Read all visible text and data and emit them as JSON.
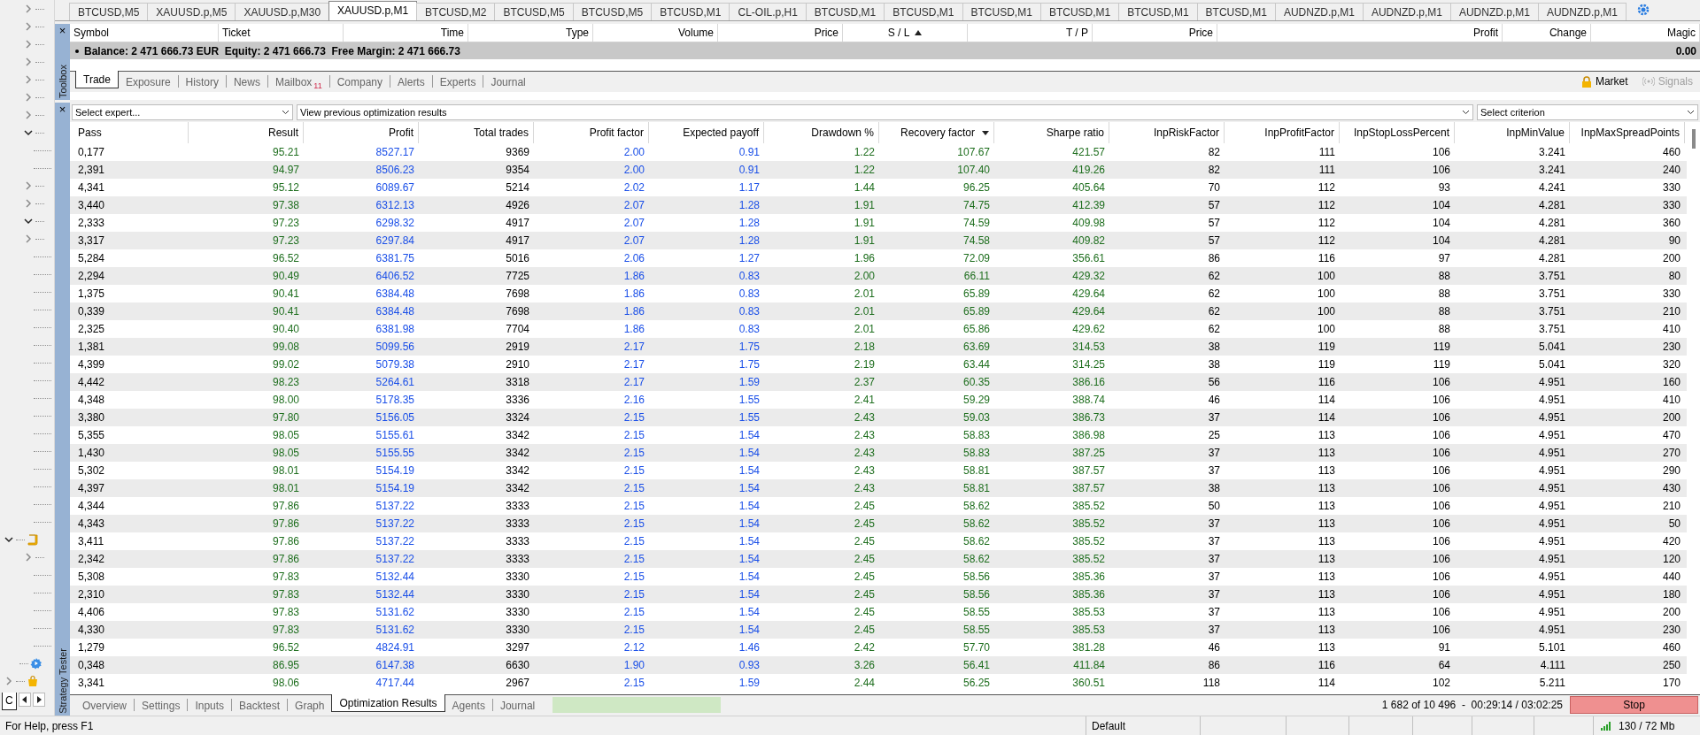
{
  "chart_tabs": [
    {
      "label": "BTCUSD,M5",
      "selected": false
    },
    {
      "label": "XAUUSD.p,M5",
      "selected": false
    },
    {
      "label": "XAUUSD.p,M30",
      "selected": false
    },
    {
      "label": "XAUUSD.p,M1",
      "selected": true
    },
    {
      "label": "BTCUSD,M2",
      "selected": false
    },
    {
      "label": "BTCUSD,M5",
      "selected": false
    },
    {
      "label": "BTCUSD,M5",
      "selected": false
    },
    {
      "label": "BTCUSD,M1",
      "selected": false
    },
    {
      "label": "CL-OIL.p,H1",
      "selected": false
    },
    {
      "label": "BTCUSD,M1",
      "selected": false
    },
    {
      "label": "BTCUSD,M1",
      "selected": false
    },
    {
      "label": "BTCUSD,M1",
      "selected": false
    },
    {
      "label": "BTCUSD,M1",
      "selected": false
    },
    {
      "label": "BTCUSD,M1",
      "selected": false
    },
    {
      "label": "BTCUSD,M1",
      "selected": false
    },
    {
      "label": "AUDNZD.p,M1",
      "selected": false
    },
    {
      "label": "AUDNZD.p,M1",
      "selected": false
    },
    {
      "label": "AUDNZD.p,M1",
      "selected": false
    },
    {
      "label": "AUDNZD.p,M1",
      "selected": false
    }
  ],
  "navigator": {
    "items": [
      {
        "kind": "group",
        "expanded": false
      },
      {
        "kind": "group",
        "expanded": false
      },
      {
        "kind": "group",
        "expanded": false
      },
      {
        "kind": "group",
        "expanded": false
      },
      {
        "kind": "group",
        "expanded": false
      },
      {
        "kind": "group",
        "expanded": false
      },
      {
        "kind": "group",
        "expanded": false
      },
      {
        "kind": "group",
        "expanded": true,
        "children": [
          {
            "kind": "leaf"
          },
          {
            "kind": "leaf"
          },
          {
            "kind": "group",
            "expanded": false
          },
          {
            "kind": "group",
            "expanded": false
          },
          {
            "kind": "group",
            "expanded": true,
            "children": [
              {
                "kind": "group",
                "expanded": false
              },
              {
                "kind": "leaf"
              },
              {
                "kind": "leaf"
              },
              {
                "kind": "leaf"
              },
              {
                "kind": "leaf"
              },
              {
                "kind": "leaf"
              },
              {
                "kind": "leaf"
              },
              {
                "kind": "leaf"
              },
              {
                "kind": "leaf"
              },
              {
                "kind": "leaf"
              },
              {
                "kind": "leaf"
              },
              {
                "kind": "leaf"
              },
              {
                "kind": "leaf"
              },
              {
                "kind": "leaf"
              },
              {
                "kind": "leaf"
              },
              {
                "kind": "leaf"
              },
              {
                "kind": "leaf"
              }
            ]
          }
        ]
      },
      {
        "kind": "scripts",
        "expanded": true,
        "children": [
          {
            "kind": "group",
            "expanded": false
          },
          {
            "kind": "leaf"
          },
          {
            "kind": "leaf"
          },
          {
            "kind": "leaf"
          },
          {
            "kind": "leaf"
          },
          {
            "kind": "leaf"
          }
        ]
      },
      {
        "kind": "services"
      },
      {
        "kind": "market",
        "expanded": false
      }
    ],
    "tab": "C"
  },
  "toolbox": {
    "title": "Toolbox",
    "close": "×",
    "columns": [
      {
        "label": "Symbol"
      },
      {
        "label": "Ticket"
      },
      {
        "label": "Time"
      },
      {
        "label": "Type"
      },
      {
        "label": "Volume"
      },
      {
        "label": "Price"
      },
      {
        "label": "S / L",
        "sorted": true,
        "ascending": true
      },
      {
        "label": "T / P"
      },
      {
        "label": "Price"
      },
      {
        "label": "Profit"
      },
      {
        "label": "Change"
      },
      {
        "label": "Magic"
      }
    ],
    "balance": {
      "text": "Balance: 2 471 666.73 EUR  Equity: 2 471 666.73  Free Margin: 2 471 666.73",
      "profit": "0.00"
    },
    "tabs": [
      {
        "label": "Trade",
        "selected": true
      },
      {
        "label": "Exposure",
        "selected": false
      },
      {
        "label": "History",
        "selected": false
      },
      {
        "label": "News",
        "selected": false
      },
      {
        "label": "Mailbox",
        "selected": false,
        "badge": "11"
      },
      {
        "label": "Company",
        "selected": false
      },
      {
        "label": "Alerts",
        "selected": false
      },
      {
        "label": "Experts",
        "selected": false
      },
      {
        "label": "Journal",
        "selected": false
      }
    ],
    "market": {
      "label": "Market",
      "disabled": false
    },
    "signals": {
      "label": "Signals",
      "disabled": true
    }
  },
  "tester": {
    "title": "Strategy Tester",
    "close": "×",
    "expert": {
      "placeholder": "Select expert..."
    },
    "results": {
      "value": "View previous optimization results"
    },
    "criterion": {
      "placeholder": "Select criterion"
    },
    "columns": [
      {
        "label": "Pass"
      },
      {
        "label": "Result"
      },
      {
        "label": "Profit"
      },
      {
        "label": "Total trades"
      },
      {
        "label": "Profit factor"
      },
      {
        "label": "Expected payoff"
      },
      {
        "label": "Drawdown %"
      },
      {
        "label": "Recovery factor",
        "sorted": true,
        "ascending": false
      },
      {
        "label": "Sharpe ratio"
      },
      {
        "label": "InpRiskFactor"
      },
      {
        "label": "InpProfitFactor"
      },
      {
        "label": "InpStopLossPercent"
      },
      {
        "label": "InpMinValue"
      },
      {
        "label": "InpMaxSpreadPoints"
      }
    ],
    "rows": [
      [
        "0,177",
        "95.21",
        "8527.17",
        "9369",
        "2.00",
        "0.91",
        "1.22",
        "107.67",
        "421.57",
        "82",
        "111",
        "106",
        "3.241",
        "460"
      ],
      [
        "2,391",
        "94.97",
        "8506.23",
        "9354",
        "2.00",
        "0.91",
        "1.22",
        "107.40",
        "419.26",
        "82",
        "111",
        "106",
        "3.241",
        "240"
      ],
      [
        "4,341",
        "95.12",
        "6089.67",
        "5214",
        "2.02",
        "1.17",
        "1.44",
        "96.25",
        "405.64",
        "70",
        "112",
        "93",
        "4.241",
        "330"
      ],
      [
        "3,440",
        "97.38",
        "6312.13",
        "4926",
        "2.07",
        "1.28",
        "1.91",
        "74.75",
        "412.39",
        "57",
        "112",
        "104",
        "4.281",
        "330"
      ],
      [
        "2,333",
        "97.23",
        "6298.32",
        "4917",
        "2.07",
        "1.28",
        "1.91",
        "74.59",
        "409.98",
        "57",
        "112",
        "104",
        "4.281",
        "360"
      ],
      [
        "3,317",
        "97.23",
        "6297.84",
        "4917",
        "2.07",
        "1.28",
        "1.91",
        "74.58",
        "409.82",
        "57",
        "112",
        "104",
        "4.281",
        "90"
      ],
      [
        "5,284",
        "96.52",
        "6381.75",
        "5016",
        "2.06",
        "1.27",
        "1.96",
        "72.09",
        "356.61",
        "86",
        "116",
        "97",
        "4.281",
        "200"
      ],
      [
        "2,294",
        "90.49",
        "6406.52",
        "7725",
        "1.86",
        "0.83",
        "2.00",
        "66.11",
        "429.32",
        "62",
        "100",
        "88",
        "3.751",
        "80"
      ],
      [
        "1,375",
        "90.41",
        "6384.48",
        "7698",
        "1.86",
        "0.83",
        "2.01",
        "65.89",
        "429.64",
        "62",
        "100",
        "88",
        "3.751",
        "330"
      ],
      [
        "0,339",
        "90.41",
        "6384.48",
        "7698",
        "1.86",
        "0.83",
        "2.01",
        "65.89",
        "429.64",
        "62",
        "100",
        "88",
        "3.751",
        "210"
      ],
      [
        "2,325",
        "90.40",
        "6381.98",
        "7704",
        "1.86",
        "0.83",
        "2.01",
        "65.86",
        "429.62",
        "62",
        "100",
        "88",
        "3.751",
        "410"
      ],
      [
        "1,381",
        "99.08",
        "5099.56",
        "2919",
        "2.17",
        "1.75",
        "2.18",
        "63.69",
        "314.53",
        "38",
        "119",
        "119",
        "5.041",
        "230"
      ],
      [
        "4,399",
        "99.02",
        "5079.38",
        "2910",
        "2.17",
        "1.75",
        "2.19",
        "63.44",
        "314.25",
        "38",
        "119",
        "119",
        "5.041",
        "320"
      ],
      [
        "4,442",
        "98.23",
        "5264.61",
        "3318",
        "2.17",
        "1.59",
        "2.37",
        "60.35",
        "386.16",
        "56",
        "116",
        "106",
        "4.951",
        "160"
      ],
      [
        "4,348",
        "98.00",
        "5178.35",
        "3336",
        "2.16",
        "1.55",
        "2.41",
        "59.29",
        "388.74",
        "46",
        "114",
        "106",
        "4.951",
        "410"
      ],
      [
        "3,380",
        "97.80",
        "5156.05",
        "3324",
        "2.15",
        "1.55",
        "2.43",
        "59.03",
        "386.73",
        "37",
        "114",
        "106",
        "4.951",
        "200"
      ],
      [
        "5,355",
        "98.05",
        "5155.61",
        "3342",
        "2.15",
        "1.54",
        "2.43",
        "58.83",
        "386.98",
        "25",
        "113",
        "106",
        "4.951",
        "470"
      ],
      [
        "1,430",
        "98.05",
        "5155.55",
        "3342",
        "2.15",
        "1.54",
        "2.43",
        "58.83",
        "387.25",
        "37",
        "113",
        "106",
        "4.951",
        "270"
      ],
      [
        "5,302",
        "98.01",
        "5154.19",
        "3342",
        "2.15",
        "1.54",
        "2.43",
        "58.81",
        "387.57",
        "37",
        "113",
        "106",
        "4.951",
        "290"
      ],
      [
        "4,397",
        "98.01",
        "5154.19",
        "3342",
        "2.15",
        "1.54",
        "2.43",
        "58.81",
        "387.57",
        "38",
        "113",
        "106",
        "4.951",
        "430"
      ],
      [
        "4,344",
        "97.86",
        "5137.22",
        "3333",
        "2.15",
        "1.54",
        "2.45",
        "58.62",
        "385.52",
        "50",
        "113",
        "106",
        "4.951",
        "210"
      ],
      [
        "4,343",
        "97.86",
        "5137.22",
        "3333",
        "2.15",
        "1.54",
        "2.45",
        "58.62",
        "385.52",
        "37",
        "113",
        "106",
        "4.951",
        "50"
      ],
      [
        "3,411",
        "97.86",
        "5137.22",
        "3333",
        "2.15",
        "1.54",
        "2.45",
        "58.62",
        "385.52",
        "37",
        "113",
        "106",
        "4.951",
        "420"
      ],
      [
        "2,342",
        "97.86",
        "5137.22",
        "3333",
        "2.15",
        "1.54",
        "2.45",
        "58.62",
        "385.52",
        "37",
        "113",
        "106",
        "4.951",
        "120"
      ],
      [
        "5,308",
        "97.83",
        "5132.44",
        "3330",
        "2.15",
        "1.54",
        "2.45",
        "58.56",
        "385.36",
        "37",
        "113",
        "106",
        "4.951",
        "440"
      ],
      [
        "2,310",
        "97.83",
        "5132.44",
        "3330",
        "2.15",
        "1.54",
        "2.45",
        "58.56",
        "385.36",
        "37",
        "113",
        "106",
        "4.951",
        "180"
      ],
      [
        "4,406",
        "97.83",
        "5131.62",
        "3330",
        "2.15",
        "1.54",
        "2.45",
        "58.55",
        "385.53",
        "37",
        "113",
        "106",
        "4.951",
        "200"
      ],
      [
        "4,330",
        "97.83",
        "5131.62",
        "3330",
        "2.15",
        "1.54",
        "2.45",
        "58.55",
        "385.53",
        "37",
        "113",
        "106",
        "4.951",
        "230"
      ],
      [
        "1,279",
        "96.52",
        "4824.91",
        "3297",
        "2.12",
        "1.46",
        "2.42",
        "57.70",
        "381.28",
        "46",
        "113",
        "91",
        "5.101",
        "460"
      ],
      [
        "0,348",
        "86.95",
        "6147.38",
        "6630",
        "1.90",
        "0.93",
        "3.26",
        "56.41",
        "411.84",
        "86",
        "116",
        "64",
        "4.111",
        "250"
      ],
      [
        "3,341",
        "98.06",
        "4717.44",
        "2967",
        "2.15",
        "1.59",
        "2.44",
        "56.25",
        "360.51",
        "118",
        "114",
        "102",
        "5.211",
        "170"
      ]
    ],
    "tabs": [
      {
        "label": "Overview",
        "selected": false
      },
      {
        "label": "Settings",
        "selected": false
      },
      {
        "label": "Inputs",
        "selected": false
      },
      {
        "label": "Backtest",
        "selected": false
      },
      {
        "label": "Graph",
        "selected": false
      },
      {
        "label": "Optimization Results",
        "selected": true
      },
      {
        "label": "Agents",
        "selected": false
      },
      {
        "label": "Journal",
        "selected": false
      }
    ],
    "progress_bar": {
      "level": 1
    },
    "progress": "1 682 of 10 496  -  00:29:14 / 03:02:25",
    "stop": "Stop"
  },
  "status_bar": {
    "help": "For Help, press F1",
    "profile": "Default",
    "traffic": "130 / 72 Mb"
  }
}
